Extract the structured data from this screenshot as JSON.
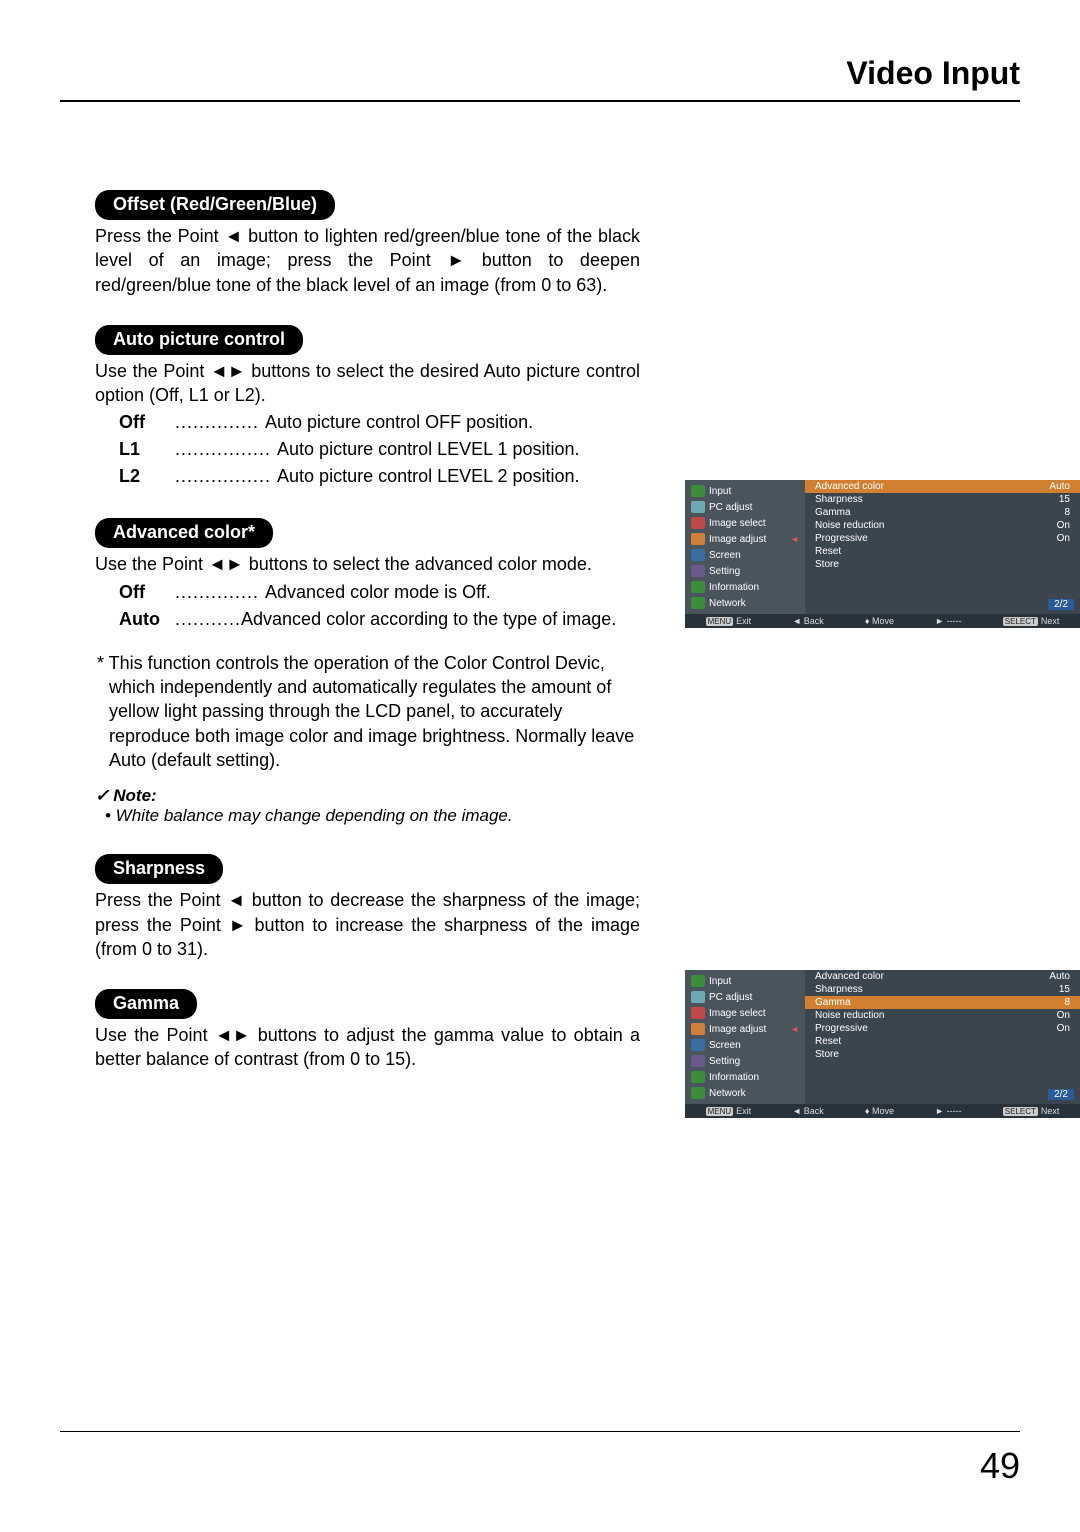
{
  "header": {
    "title": "Video Input"
  },
  "page_number": "49",
  "sections": {
    "offset": {
      "heading": "Offset (Red/Green/Blue)",
      "body": "Press the Point ◄ button to lighten red/green/blue tone of the black level of an image; press the Point ► button to deepen red/green/blue tone of the black level of an image (from 0 to 63)."
    },
    "autopic": {
      "heading": "Auto picture control",
      "intro": "Use the Point ◄► buttons to select the desired Auto picture control option (Off, L1 or L2).",
      "rows": [
        {
          "label": "Off",
          "dots": ".............. ",
          "desc": "Auto picture control OFF position."
        },
        {
          "label": "L1",
          "dots": "................ ",
          "desc": "Auto picture control LEVEL 1 position."
        },
        {
          "label": "L2",
          "dots": "................ ",
          "desc": "Auto picture control LEVEL 2 position."
        }
      ]
    },
    "advcolor": {
      "heading": "Advanced color*",
      "intro": "Use the Point ◄► buttons to select the advanced color mode.",
      "rows": [
        {
          "label": "Off",
          "dots": ".............. ",
          "desc": "Advanced color mode is Off."
        },
        {
          "label": "Auto",
          "dots": "........... ",
          "desc": "Advanced color according to the type of image."
        }
      ],
      "star": "* This function controls the operation of the Color Control Devic, which independently and automatically regulates the amount of yellow light passing through the LCD panel, to accurately reproduce both image color and image brightness. Normally leave Auto (default setting).",
      "note_head": "Note:",
      "note_body": "• White balance may change depending on the image."
    },
    "sharpness": {
      "heading": "Sharpness",
      "body": "Press the Point ◄ button to decrease the sharpness of the image; press the Point ► button to increase the sharpness of the image (from 0 to 31)."
    },
    "gamma": {
      "heading": "Gamma",
      "body": "Use the Point ◄► buttons to adjust the gamma value to obtain a better balance of contrast (from 0 to 15)."
    }
  },
  "osd_nav": [
    {
      "label": "Input",
      "icon_class": "ic-green"
    },
    {
      "label": "PC adjust",
      "icon_class": "ic-cyan"
    },
    {
      "label": "Image select",
      "icon_class": "ic-red"
    },
    {
      "label": "Image adjust",
      "icon_class": "ic-orange",
      "pointer": true
    },
    {
      "label": "Screen",
      "icon_class": "ic-blue"
    },
    {
      "label": "Setting",
      "icon_class": "ic-purple"
    },
    {
      "label": "Information",
      "icon_class": "ic-green"
    },
    {
      "label": "Network",
      "icon_class": "ic-green"
    }
  ],
  "osd_top": {
    "rows": [
      {
        "label": "Advanced color",
        "value": "Auto",
        "hilite": true
      },
      {
        "label": "Sharpness",
        "value": "15"
      },
      {
        "label": "Gamma",
        "value": "8"
      },
      {
        "label": "Noise reduction",
        "value": "On"
      },
      {
        "label": "Progressive",
        "value": "On"
      },
      {
        "label": "Reset",
        "value": ""
      },
      {
        "label": "Store",
        "value": ""
      }
    ],
    "page": "2/2"
  },
  "osd_bot": {
    "rows": [
      {
        "label": "Advanced color",
        "value": "Auto"
      },
      {
        "label": "Sharpness",
        "value": "15"
      },
      {
        "label": "Gamma",
        "value": "8",
        "hilite": true
      },
      {
        "label": "Noise reduction",
        "value": "On"
      },
      {
        "label": "Progressive",
        "value": "On"
      },
      {
        "label": "Reset",
        "value": ""
      },
      {
        "label": "Store",
        "value": ""
      }
    ],
    "page": "2/2"
  },
  "osd_footer": {
    "exit": "Exit",
    "back": "Back",
    "move": "Move",
    "dash": "-----",
    "next": "Next",
    "menu_key": "MENU",
    "select_key": "SELECT"
  }
}
